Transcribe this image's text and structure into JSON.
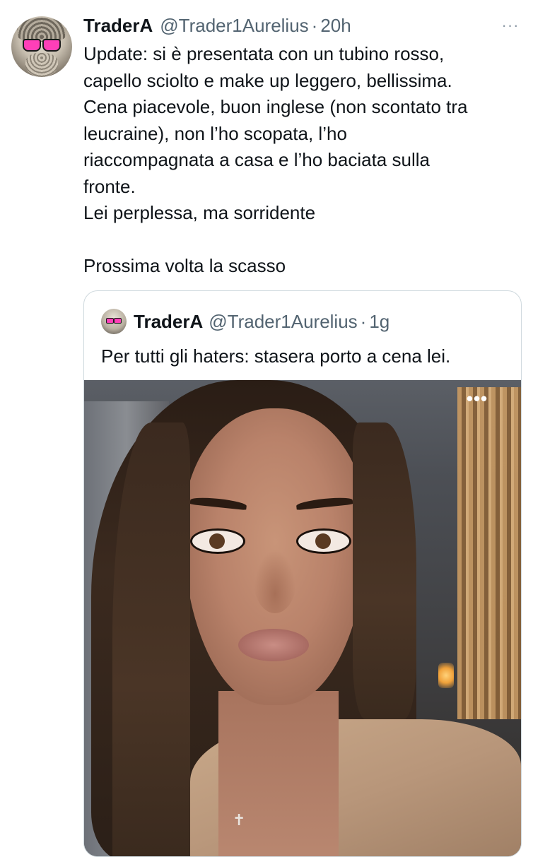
{
  "tweet": {
    "author": {
      "name": "TraderA",
      "handle": "@Trader1Aurelius",
      "separator": "·",
      "time": "20h",
      "avatar_icon": "stoic-bust-pink-sunglasses-avatar"
    },
    "more_icon": "more-dots-icon",
    "more_label": "···",
    "text_lines": [
      "Update: si è presentata con un tubino rosso,",
      "capello sciolto e make up leggero, bellissima.",
      "Cena piacevole, buon inglese (non scontato tra",
      "leucraine), non l’ho scopata, l’ho",
      "riaccompagnata a casa e l’ho baciata sulla",
      "fronte.",
      "Lei perplessa, ma sorridente",
      "",
      "Prossima volta la scasso"
    ]
  },
  "quoted_tweet": {
    "author": {
      "name": "TraderA",
      "handle": "@Trader1Aurelius",
      "separator": "·",
      "time": "1g",
      "avatar_icon": "stoic-bust-pink-sunglasses-avatar"
    },
    "text": "Per tutti gli haters: stasera porto a cena lei.",
    "media": {
      "type": "photo",
      "description_icon": "portrait-photo",
      "more_label": "•••",
      "necklace_glyph": "✝"
    }
  },
  "colors": {
    "text_primary": "#0f1419",
    "text_secondary": "#536471",
    "border": "#cfd9de"
  }
}
